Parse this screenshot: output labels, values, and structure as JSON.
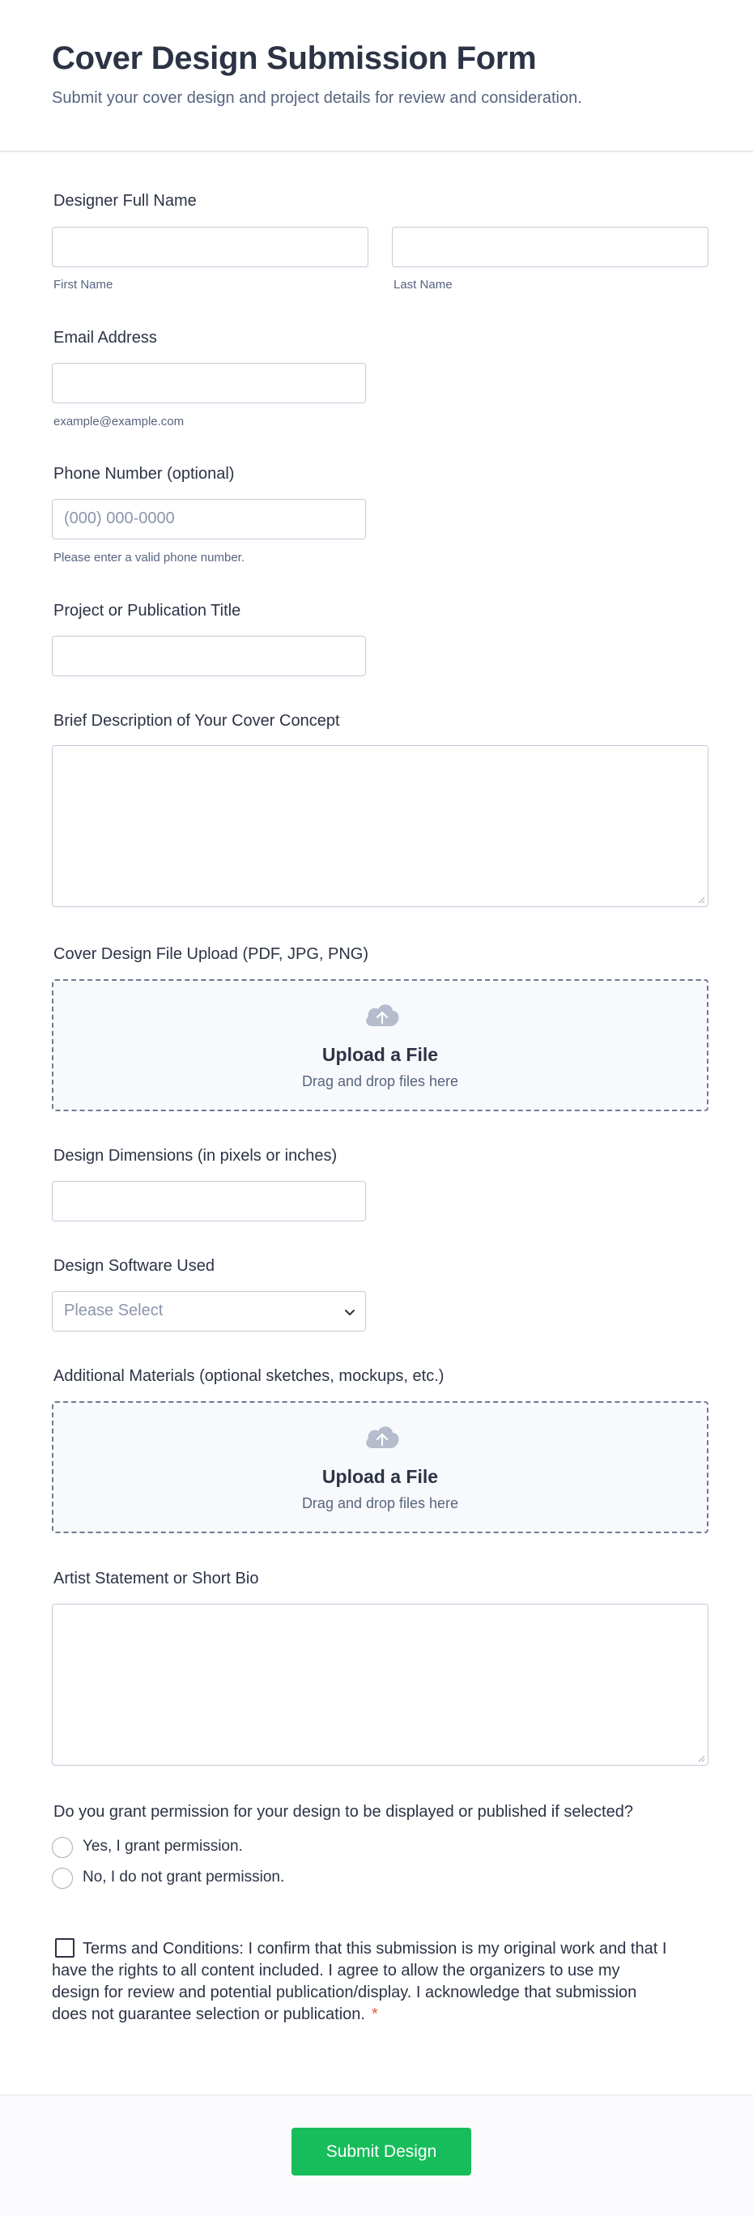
{
  "header": {
    "title": "Cover Design Submission Form",
    "subtitle": "Submit your cover design and project details for review and consideration."
  },
  "designer_name": {
    "label": "Designer Full Name",
    "first_sublabel": "First Name",
    "last_sublabel": "Last Name",
    "first_value": "",
    "last_value": ""
  },
  "email": {
    "label": "Email Address",
    "value": "",
    "sublabel": "example@example.com"
  },
  "phone": {
    "label": "Phone Number (optional)",
    "placeholder": "(000) 000-0000",
    "sublabel": "Please enter a valid phone number."
  },
  "project_title": {
    "label": "Project or Publication Title",
    "value": ""
  },
  "concept": {
    "label": "Brief Description of Your Cover Concept",
    "value": ""
  },
  "cover_upload": {
    "label": "Cover Design File Upload (PDF, JPG, PNG)",
    "button_title": "Upload a File",
    "hint": "Drag and drop files here",
    "icon": "cloud-upload-icon"
  },
  "dimensions": {
    "label": "Design Dimensions (in pixels or inches)",
    "value": ""
  },
  "software": {
    "label": "Design Software Used",
    "selected": "Please Select",
    "icon": "chevron-down-icon"
  },
  "materials_upload": {
    "label": "Additional Materials (optional sketches, mockups, etc.)",
    "button_title": "Upload a File",
    "hint": "Drag and drop files here",
    "icon": "cloud-upload-icon"
  },
  "bio": {
    "label": "Artist Statement or Short Bio",
    "value": ""
  },
  "permission": {
    "question": "Do you grant permission for your design to be displayed or published if selected?",
    "options": [
      {
        "label": "Yes, I grant permission.",
        "checked": false
      },
      {
        "label": "No, I do not grant permission.",
        "checked": false
      }
    ]
  },
  "terms": {
    "text": "Terms and Conditions: I confirm that this submission is my original work and that I have the rights to all content included. I agree to allow the organizers to use my design for review and potential publication/display. I acknowledge that submission does not guarantee selection or publication.",
    "required_mark": "*",
    "checked": false
  },
  "submit": {
    "label": "Submit Design"
  },
  "colors": {
    "text": "#2c3345",
    "muted": "#57647e",
    "border": "#c3cad8",
    "submit": "#18bd5b",
    "required": "#e05a3a"
  }
}
